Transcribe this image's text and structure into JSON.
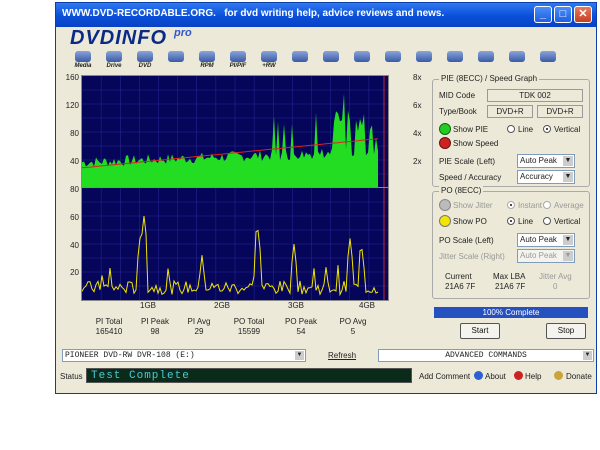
{
  "window": {
    "title": "WWW.DVD-RECORDABLE.ORG.   for dvd writing help, advice reviews and news.",
    "logo": "DVDINFO",
    "logo_suffix": "pro"
  },
  "toolbar": [
    "Media",
    "Drive",
    "DVD",
    "",
    "RPM",
    "PI/PIF",
    "+RW",
    "",
    "",
    "",
    "",
    "",
    "",
    "",
    "",
    ""
  ],
  "graph": {
    "top_y_left": [
      "160",
      "120",
      "80",
      "40"
    ],
    "top_y_right": [
      "8x",
      "6x",
      "4x",
      "2x"
    ],
    "bot_y_left": [
      "80",
      "60",
      "40",
      "20"
    ],
    "x_labels": [
      "1GB",
      "2GB",
      "3GB",
      "4GB"
    ]
  },
  "stats": [
    {
      "label": "PI Total",
      "value": "165410"
    },
    {
      "label": "PI Peak",
      "value": "98"
    },
    {
      "label": "PI Avg",
      "value": "29"
    },
    {
      "label": "PO Total",
      "value": "15599"
    },
    {
      "label": "PO Peak",
      "value": "54"
    },
    {
      "label": "PO Avg",
      "value": "5"
    }
  ],
  "pie": {
    "group_title": "PIE (8ECC) / Speed Graph",
    "mid_code_label": "MID Code",
    "mid_code": "TDK    002",
    "type_book_label": "Type/Book",
    "type": "DVD+R",
    "book": "DVD+R",
    "show_pie": "Show PIE",
    "show_speed": "Show Speed",
    "line": "Line",
    "vertical": "Vertical",
    "scale_label": "PIE Scale (Left)",
    "scale_value": "Auto Peak",
    "speed_label": "Speed / Accuracy",
    "speed_value": "Accuracy"
  },
  "po": {
    "group_title": "PO (8ECC)",
    "show_jitter": "Show Jitter",
    "instant": "Instant",
    "average": "Average",
    "show_po": "Show PO",
    "line": "Line",
    "vertical": "Vertical",
    "scale_label": "PO Scale (Left)",
    "scale_value": "Auto Peak",
    "jitter_label": "Jitter Scale (Right)",
    "jitter_value": "Auto Peak",
    "current_label": "Current",
    "current_value": "21A6 7F",
    "maxlba_label": "Max LBA",
    "maxlba_value": "21A6 7F",
    "jitter_avg_label": "Jitter Avg",
    "jitter_avg_value": "0"
  },
  "progress": {
    "text": "100% Complete",
    "percent": 100
  },
  "buttons": {
    "start": "Start",
    "stop": "Stop",
    "refresh": "Refresh"
  },
  "drive": "PIONEER  DVD-RW   DVR-108   (E:)",
  "advanced": "ADVANCED COMMANDS",
  "status": {
    "label": "Status",
    "text": "Test Complete"
  },
  "bottom": {
    "add_comment": "Add Comment",
    "about": "About",
    "help": "Help",
    "donate": "Donate"
  }
}
